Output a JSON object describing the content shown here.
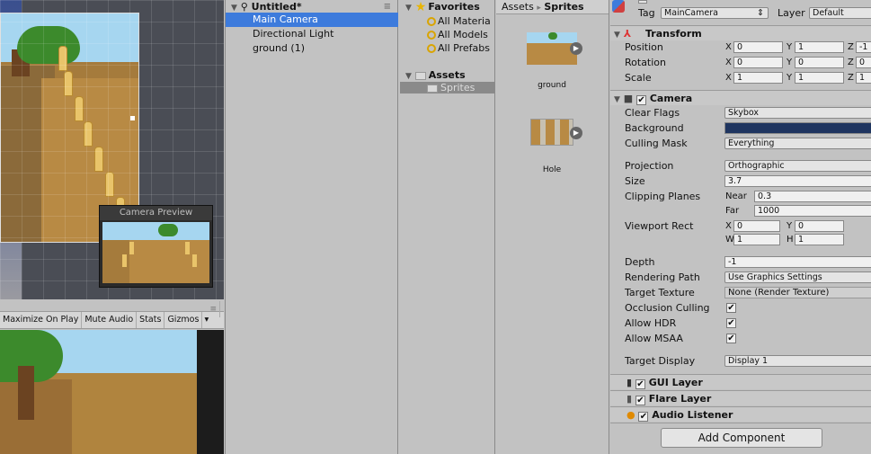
{
  "scene_view": {
    "camera_preview_title": "Camera Preview"
  },
  "game_view": {
    "toolbar": [
      "Maximize On Play",
      "Mute Audio",
      "Stats",
      "Gizmos"
    ],
    "menu_icon": "≡"
  },
  "hierarchy": {
    "scene_name": "Untitled*",
    "items": [
      {
        "label": "Main Camera",
        "selected": true
      },
      {
        "label": "Directional Light",
        "selected": false
      },
      {
        "label": "ground (1)",
        "selected": false
      }
    ]
  },
  "project": {
    "favorites_label": "Favorites",
    "favorites": [
      "All Materia",
      "All Models",
      "All Prefabs"
    ],
    "assets_label": "Assets",
    "sprites_folder": "Sprites",
    "breadcrumb_root": "Assets",
    "breadcrumb_sep": "▸",
    "breadcrumb_current": "Sprites",
    "files": [
      "ground",
      "Hole"
    ]
  },
  "inspector": {
    "tag_label": "Tag",
    "tag_value": "MainCamera",
    "layer_label": "Layer",
    "layer_value": "Default",
    "transform": {
      "title": "Transform",
      "position_label": "Position",
      "rotation_label": "Rotation",
      "scale_label": "Scale",
      "position": {
        "x": "0",
        "y": "1",
        "z": "-1"
      },
      "rotation": {
        "x": "0",
        "y": "0",
        "z": "0"
      },
      "scale": {
        "x": "1",
        "y": "1",
        "z": "1"
      }
    },
    "camera": {
      "title": "Camera",
      "clear_flags_label": "Clear Flags",
      "clear_flags": "Skybox",
      "background_label": "Background",
      "background_color": "#1f3560",
      "culling_mask_label": "Culling Mask",
      "culling_mask": "Everything",
      "projection_label": "Projection",
      "projection": "Orthographic",
      "size_label": "Size",
      "size": "3.7",
      "clipping_label": "Clipping Planes",
      "near_label": "Near",
      "near": "0.3",
      "far_label": "Far",
      "far": "1000",
      "viewport_label": "Viewport Rect",
      "viewport": {
        "x": "0",
        "y": "0",
        "w": "1",
        "h": "1"
      },
      "depth_label": "Depth",
      "depth": "-1",
      "rendering_path_label": "Rendering Path",
      "rendering_path": "Use Graphics Settings",
      "target_texture_label": "Target Texture",
      "target_texture": "None (Render Texture)",
      "occlusion_label": "Occlusion Culling",
      "allow_hdr_label": "Allow HDR",
      "allow_msaa_label": "Allow MSAA",
      "target_display_label": "Target Display",
      "target_display": "Display 1"
    },
    "components": [
      "GUI Layer",
      "Flare Layer",
      "Audio Listener"
    ],
    "add_component": "Add Component",
    "axis": {
      "x": "X",
      "y": "Y",
      "z": "Z",
      "w": "W",
      "h": "H"
    },
    "check_mark": "✔"
  }
}
